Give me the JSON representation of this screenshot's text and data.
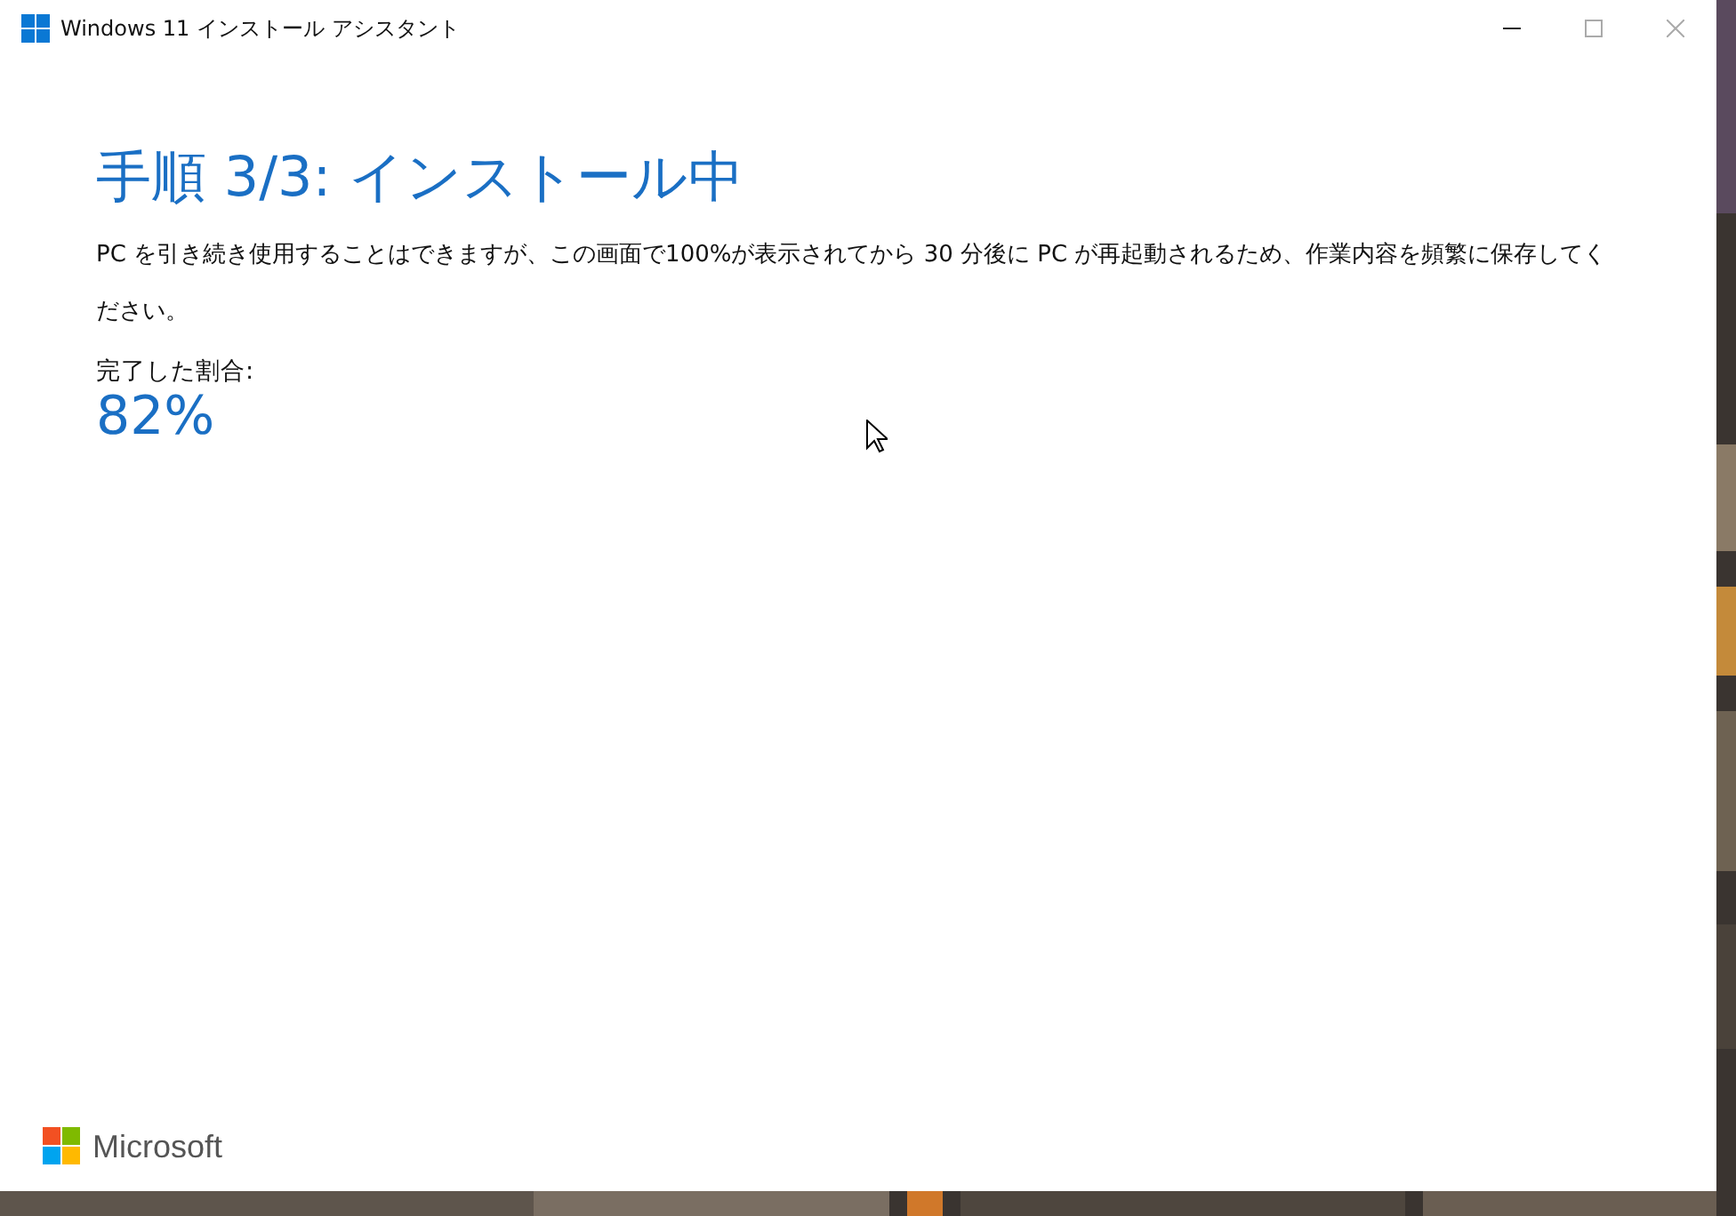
{
  "window": {
    "title": "Windows 11 インストール アシスタント"
  },
  "heading": "手順 3/3: インストール中",
  "description": "PC を引き続き使用することはできますが、この画面で100%が表示されてから 30 分後に PC が再起動されるため、作業内容を頻繁に保存してください。",
  "progress": {
    "label": "完了した割合:",
    "value": "82%"
  },
  "footer": {
    "brand": "Microsoft"
  }
}
